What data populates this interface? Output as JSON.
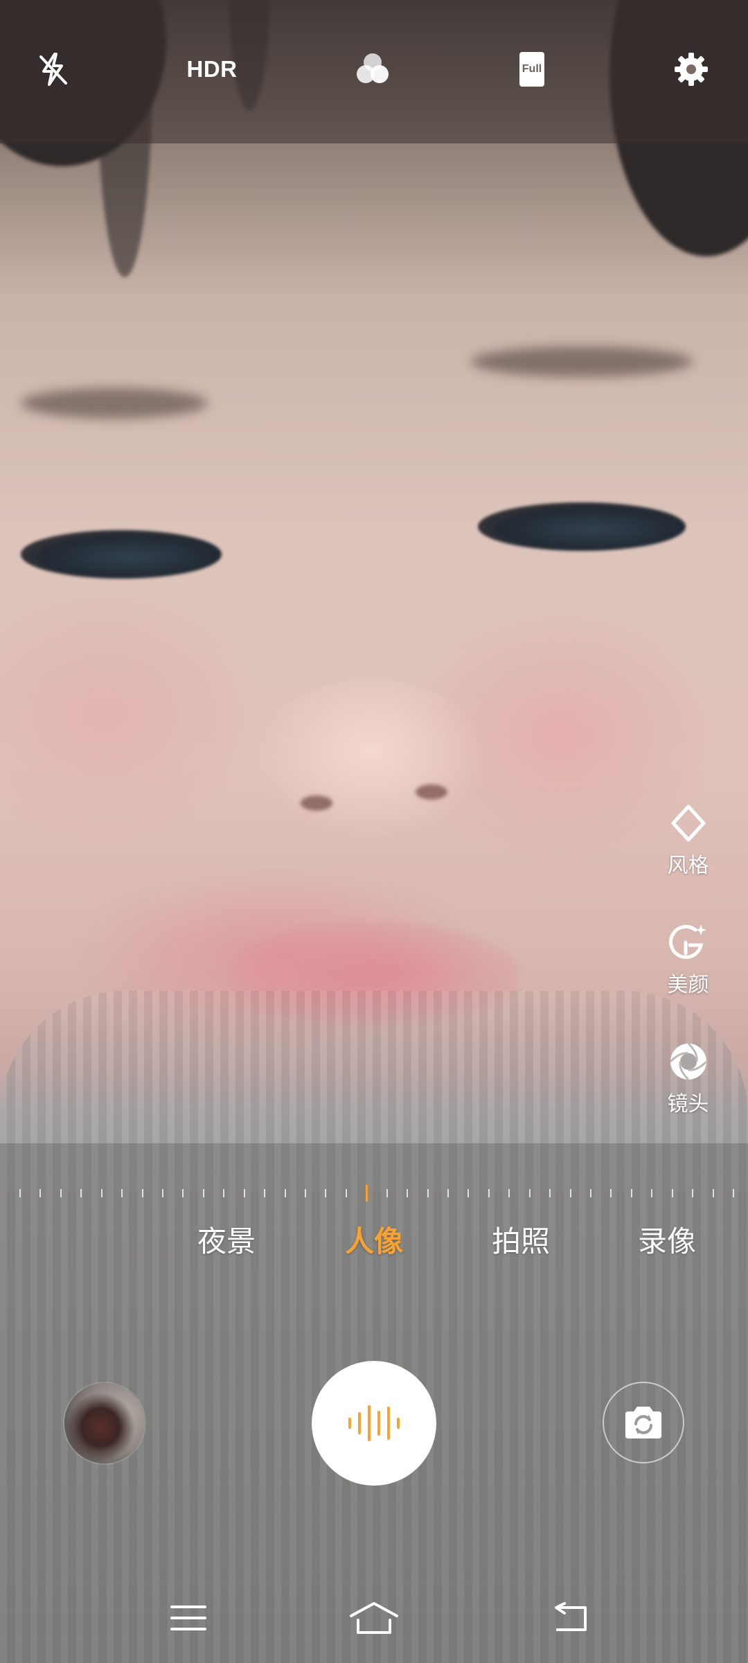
{
  "top_bar": {
    "flash": {
      "icon": "flash-off-icon",
      "label": ""
    },
    "hdr": {
      "label": "HDR"
    },
    "filter": {
      "icon": "filter-circles-icon"
    },
    "aspect_ratio": {
      "label": "Full"
    },
    "settings": {
      "icon": "gear-icon"
    }
  },
  "side_features": [
    {
      "label": "风格",
      "icon": "diamond-sparkle-icon"
    },
    {
      "label": "美颜",
      "icon": "beauty-face-icon"
    },
    {
      "label": "镜头",
      "icon": "lens-aperture-icon"
    }
  ],
  "zoom_ruler": {
    "active_index": 17,
    "tick_count": 36
  },
  "modes": {
    "items": [
      "夜景",
      "人像",
      "拍照",
      "录像"
    ],
    "selected": "人像"
  },
  "controls": {
    "gallery": {
      "icon": "gallery-thumbnail"
    },
    "shutter": {
      "icon": "sound-wave-icon"
    },
    "switch_camera": {
      "icon": "switch-camera-icon"
    }
  },
  "nav_bar": {
    "menu": {
      "icon": "menu-icon"
    },
    "home": {
      "icon": "home-icon"
    },
    "back": {
      "icon": "back-icon"
    }
  },
  "colors": {
    "accent": "#f7a232",
    "text": "#ffffff"
  }
}
